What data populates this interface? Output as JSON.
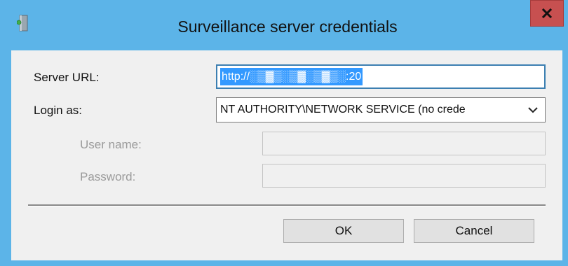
{
  "window": {
    "title": "Surveillance server credentials",
    "close_label": "x"
  },
  "form": {
    "server_url_label": "Server URL:",
    "server_url_value": "http://░▒▓▒░▒▓░▒▓▒░:20",
    "login_as_label": "Login as:",
    "login_as_value": "NT AUTHORITY\\NETWORK SERVICE (no crede",
    "username_label": "User name:",
    "username_value": "",
    "password_label": "Password:",
    "password_value": ""
  },
  "buttons": {
    "ok_label": "OK",
    "cancel_label": "Cancel"
  },
  "colors": {
    "title_bar": "#5cb4e8",
    "close_button": "#c75050",
    "selection": "#3399ff"
  }
}
